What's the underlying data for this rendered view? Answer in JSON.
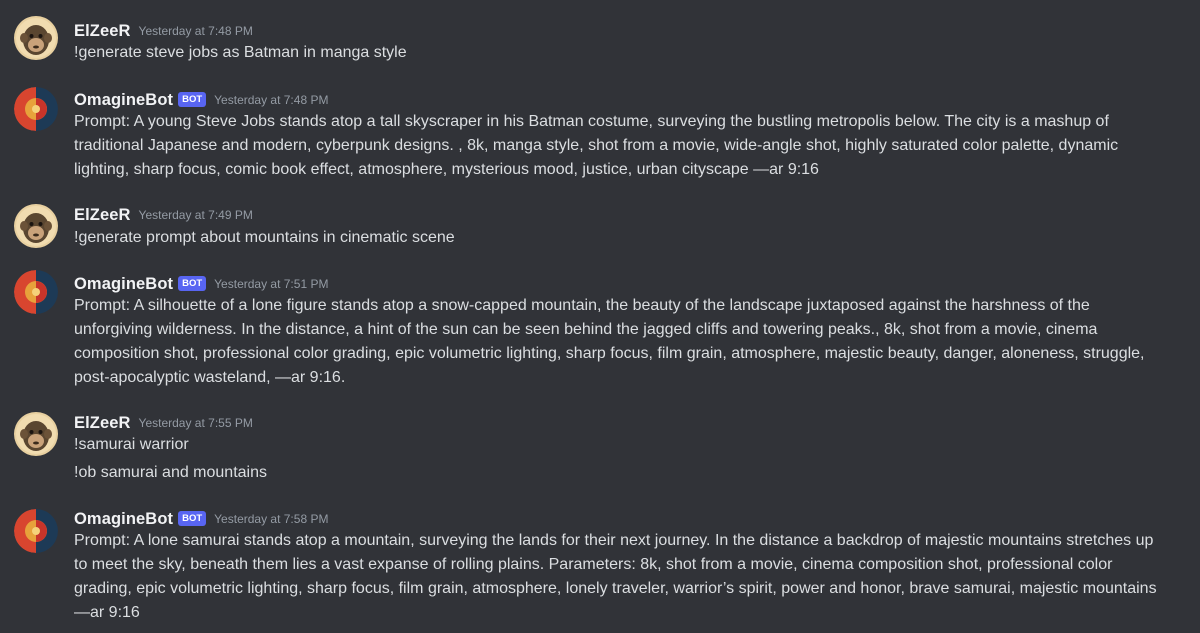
{
  "messages": [
    {
      "author": "ElZeeR",
      "bot": false,
      "timestamp": "Yesterday at 7:48 PM",
      "lines": [
        "!generate steve jobs as Batman in manga style"
      ]
    },
    {
      "author": "OmagineBot",
      "bot": true,
      "badge": "BOT",
      "timestamp": "Yesterday at 7:48 PM",
      "lines": [
        "Prompt: A young Steve Jobs stands atop a tall skyscraper in his Batman costume, surveying the bustling metropolis below. The city is a mashup of",
        "traditional Japanese and modern, cyberpunk designs. , 8k, manga style, shot from a movie, wide-angle shot, highly saturated color palette, dynamic",
        "lighting, sharp focus, comic book effect, atmosphere, mysterious mood, justice, urban cityscape —ar 9:16"
      ]
    },
    {
      "author": "ElZeeR",
      "bot": false,
      "timestamp": "Yesterday at 7:49 PM",
      "lines": [
        "!generate prompt about mountains in cinematic scene"
      ]
    },
    {
      "author": "OmagineBot",
      "bot": true,
      "badge": "BOT",
      "timestamp": "Yesterday at 7:51 PM",
      "lines": [
        "Prompt: A silhouette of a lone figure stands atop a snow-capped mountain, the beauty of the landscape juxtaposed against the harshness of the",
        "unforgiving wilderness. In the distance, a hint of the sun can be seen behind the jagged cliffs and towering peaks., 8k, shot from a movie, cinema",
        "composition shot, professional color grading, epic volumetric lighting, sharp focus, film grain, atmosphere, majestic beauty, danger, aloneness, struggle,",
        "post-apocalyptic wasteland, —ar 9:16."
      ]
    },
    {
      "author": "ElZeeR",
      "bot": false,
      "timestamp": "Yesterday at 7:55 PM",
      "lines": [
        "!samurai warrior",
        "!ob samurai and mountains"
      ]
    },
    {
      "author": "OmagineBot",
      "bot": true,
      "badge": "BOT",
      "timestamp": "Yesterday at 7:58 PM",
      "lines": [
        "Prompt: A lone samurai stands atop a mountain, surveying the lands for their next journey. In the distance a backdrop of majestic mountains stretches up",
        "to meet the sky, beneath them lies a vast expanse of rolling plains. Parameters: 8k, shot from a movie, cinema composition shot, professional color",
        "grading, epic volumetric lighting, sharp focus, film grain, atmosphere, lonely traveler, warrior’s spirit, power and honor, brave samurai, majestic mountains",
        "—ar 9:16"
      ]
    }
  ]
}
